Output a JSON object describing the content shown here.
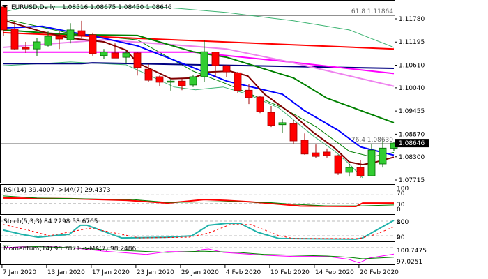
{
  "header": {
    "symbol": "EURUSD,Daily",
    "ohlc": "1.08516 1.08675 1.08450 1.08646"
  },
  "chart_data": {
    "type": "candlestick",
    "title": "EURUSD,Daily",
    "price_axis": {
      "ticks": [
        "1.11780",
        "1.11195",
        "1.10610",
        "1.10040",
        "1.09455",
        "1.08870",
        "1.08300",
        "1.07715"
      ],
      "current": "1.08646",
      "current_value": 1.08646
    },
    "x_labels": [
      {
        "i": -0.1,
        "label": "7 Jan 2020"
      },
      {
        "i": 3.9,
        "label": "13 Jan 2020"
      },
      {
        "i": 7.9,
        "label": "17 Jan 2020"
      },
      {
        "i": 11.9,
        "label": "23 Jan 2020"
      },
      {
        "i": 15.9,
        "label": "29 Jan 2020"
      },
      {
        "i": 19.9,
        "label": "4 Feb 2020"
      },
      {
        "i": 23.9,
        "label": "10 Feb 2020"
      },
      {
        "i": 27.9,
        "label": "14 Feb 2020"
      },
      {
        "i": 31.9,
        "label": "20 Feb 2020"
      }
    ],
    "fib_levels": [
      {
        "label": "61.8 1.11864",
        "value": 1.11864
      },
      {
        "label": "76.4 1.08630",
        "value": 1.0863
      }
    ],
    "candles": [
      [
        1.1208,
        1.1208,
        1.1134,
        1.115
      ],
      [
        1.1152,
        1.1173,
        1.1099,
        1.1102
      ],
      [
        1.1106,
        1.112,
        1.1092,
        1.1102
      ],
      [
        1.1102,
        1.1129,
        1.1083,
        1.112
      ],
      [
        1.1111,
        1.1146,
        1.1108,
        1.1134
      ],
      [
        1.1134,
        1.1146,
        1.1102,
        1.1127
      ],
      [
        1.1125,
        1.1167,
        1.1116,
        1.115
      ],
      [
        1.1148,
        1.1173,
        1.1129,
        1.1136
      ],
      [
        1.1138,
        1.1143,
        1.1085,
        1.109
      ],
      [
        1.1085,
        1.1102,
        1.1076,
        1.1094
      ],
      [
        1.1092,
        1.1116,
        1.1079,
        1.1079
      ],
      [
        1.1081,
        1.1097,
        1.1067,
        1.1092
      ],
      [
        1.1092,
        1.1094,
        1.1035,
        1.1055
      ],
      [
        1.1051,
        1.1064,
        1.1018,
        1.1023
      ],
      [
        1.1032,
        1.1035,
        1.1009,
        1.1018
      ],
      [
        1.1018,
        1.1027,
        1.0997,
        1.1021
      ],
      [
        1.1021,
        1.1028,
        1.0998,
        1.1009
      ],
      [
        1.1011,
        1.1037,
        1.1006,
        1.1032
      ],
      [
        1.1032,
        1.1125,
        1.1018,
        1.1095
      ],
      [
        1.1094,
        1.1094,
        1.1032,
        1.106
      ],
      [
        1.106,
        1.1062,
        1.1032,
        1.1044
      ],
      [
        1.1042,
        1.1044,
        1.0991,
        1.0997
      ],
      [
        1.0998,
        1.1014,
        1.0963,
        1.0979
      ],
      [
        1.0981,
        1.0984,
        1.094,
        1.0944
      ],
      [
        1.0942,
        1.0958,
        1.0905,
        1.0909
      ],
      [
        1.0911,
        1.0925,
        1.0891,
        1.0916
      ],
      [
        1.0914,
        1.0923,
        1.0863,
        1.087
      ],
      [
        1.0872,
        1.0889,
        1.0835,
        1.0837
      ],
      [
        1.084,
        1.0861,
        1.0826,
        1.0831
      ],
      [
        1.0842,
        1.0851,
        1.0828,
        1.0833
      ],
      [
        1.0833,
        1.0835,
        1.0784,
        1.0789
      ],
      [
        1.0791,
        1.0812,
        1.078,
        1.0803
      ],
      [
        1.0803,
        1.0821,
        1.0777,
        1.0782
      ],
      [
        1.0782,
        1.0863,
        1.0782,
        1.0847
      ],
      [
        1.0812,
        1.087,
        1.0803,
        1.0852
      ],
      [
        1.08516,
        1.08675,
        1.0845,
        1.08646
      ]
    ],
    "lines": [
      {
        "name": "upper-band",
        "color": "#3cb371",
        "width": 1,
        "points": [
          [
            0,
            1.1195
          ],
          [
            2,
            1.1208
          ],
          [
            14,
            1.1208
          ],
          [
            20,
            1.1194
          ],
          [
            26,
            1.1173
          ],
          [
            31,
            1.115
          ],
          [
            35,
            1.1106
          ]
        ]
      },
      {
        "name": "lower-band",
        "color": "#3cb371",
        "width": 1,
        "points": [
          [
            0,
            1.106
          ],
          [
            6,
            1.1069
          ],
          [
            11,
            1.1062
          ],
          [
            15.3,
            1.1006
          ],
          [
            17.2,
            1.0999
          ],
          [
            19.7,
            1.1006
          ],
          [
            21.9,
            1.0988
          ],
          [
            24.7,
            1.0953
          ],
          [
            27.8,
            1.0882
          ],
          [
            29.7,
            1.0844
          ],
          [
            31,
            1.0812
          ],
          [
            32.2,
            1.0777
          ]
        ]
      },
      {
        "name": "mid-band",
        "color": "#008000",
        "width": 1,
        "points": [
          [
            0,
            1.1178
          ],
          [
            6,
            1.1141
          ],
          [
            12,
            1.1125
          ],
          [
            17,
            1.1046
          ],
          [
            20,
            1.1014
          ],
          [
            25,
            1.0954
          ],
          [
            28,
            1.0906
          ],
          [
            31,
            1.0844
          ],
          [
            33,
            1.083
          ],
          [
            35,
            1.0841
          ]
        ]
      },
      {
        "name": "ma-red",
        "color": "#ff0000",
        "width": 2,
        "points": [
          [
            0,
            1.1143
          ],
          [
            17,
            1.1123
          ],
          [
            35,
            1.1102
          ]
        ]
      },
      {
        "name": "ma-navy",
        "color": "#000080",
        "width": 2,
        "points": [
          [
            0,
            1.1065
          ],
          [
            7,
            1.1065
          ],
          [
            8,
            1.1067
          ],
          [
            35,
            1.1053
          ]
        ]
      },
      {
        "name": "ma-magenta",
        "color": "#ff00ff",
        "width": 2,
        "points": [
          [
            0,
            1.1094
          ],
          [
            17,
            1.1094
          ],
          [
            25,
            1.1071
          ],
          [
            35,
            1.104
          ]
        ]
      },
      {
        "name": "ma-violet",
        "color": "#ee82ee",
        "width": 2,
        "points": [
          [
            0,
            1.1106
          ],
          [
            9,
            1.1125
          ],
          [
            17,
            1.1109
          ],
          [
            20,
            1.1102
          ],
          [
            26,
            1.1067
          ],
          [
            35,
            1.1008
          ]
        ]
      },
      {
        "name": "ma-green",
        "color": "#008000",
        "width": 2,
        "points": [
          [
            0,
            1.115
          ],
          [
            6,
            1.1138
          ],
          [
            12,
            1.1136
          ],
          [
            17,
            1.1095
          ],
          [
            20,
            1.1081
          ],
          [
            26,
            1.1029
          ],
          [
            29,
            1.0978
          ],
          [
            35,
            1.0916
          ]
        ]
      },
      {
        "name": "ma-blue",
        "color": "#0000ff",
        "width": 2,
        "points": [
          [
            0,
            1.1155
          ],
          [
            3.5,
            1.1159
          ],
          [
            6,
            1.1145
          ],
          [
            9,
            1.1129
          ],
          [
            12,
            1.111
          ],
          [
            17,
            1.1055
          ],
          [
            20,
            1.1021
          ],
          [
            25,
            1.0988
          ],
          [
            27,
            1.0946
          ],
          [
            30,
            1.0897
          ],
          [
            32,
            1.0855
          ],
          [
            35,
            1.0834
          ]
        ]
      },
      {
        "name": "ma-darkred",
        "color": "#800000",
        "width": 2,
        "points": [
          [
            0.2,
            1.1173
          ],
          [
            3.4,
            1.1146
          ],
          [
            6,
            1.1129
          ],
          [
            9,
            1.112
          ],
          [
            11,
            1.1099
          ],
          [
            12,
            1.1067
          ],
          [
            15,
            1.1027
          ],
          [
            17,
            1.1029
          ],
          [
            18.4,
            1.1044
          ],
          [
            20.3,
            1.1046
          ],
          [
            21.9,
            1.1034
          ],
          [
            23.4,
            1.0988
          ],
          [
            26,
            1.0935
          ],
          [
            27.8,
            1.0891
          ],
          [
            29.7,
            1.0852
          ],
          [
            31,
            1.0817
          ],
          [
            32.2,
            1.081
          ],
          [
            33.4,
            1.0817
          ],
          [
            35,
            1.0829
          ]
        ]
      }
    ],
    "indicators": {
      "rsi": {
        "label": "RSI(14) 39.4007  ->MA(7) 29.4373",
        "range": [
          0,
          100
        ],
        "levels": [
          70,
          30
        ],
        "axis": [
          "100",
          "70",
          "30",
          "0"
        ],
        "series": [
          {
            "name": "rsi",
            "color": "#ff0000",
            "width": 2,
            "points": [
              [
                0,
                55
              ],
              [
                6,
                52
              ],
              [
                11,
                45
              ],
              [
                14.7,
                32
              ],
              [
                16,
                38
              ],
              [
                18,
                48
              ],
              [
                20,
                44
              ],
              [
                22,
                38
              ],
              [
                24,
                30
              ],
              [
                26.6,
                18
              ],
              [
                31.6,
                16
              ],
              [
                32.2,
                32
              ],
              [
                35,
                32
              ]
            ]
          },
          {
            "name": "rsi-ma",
            "color": "#008000",
            "width": 1,
            "points": [
              [
                0,
                65
              ],
              [
                3,
                55
              ],
              [
                11.6,
                48
              ],
              [
                14.7,
                35
              ],
              [
                18,
                37
              ],
              [
                20.3,
                39
              ],
              [
                24,
                34
              ],
              [
                26,
                26
              ],
              [
                29,
                19
              ],
              [
                32.2,
                19
              ],
              [
                35,
                23
              ]
            ]
          }
        ]
      },
      "stoch": {
        "label": "Stoch(5,3,3) 84.2298 58.6765",
        "range": [
          0,
          100
        ],
        "levels": [
          80,
          20
        ],
        "axis": [
          "80",
          "100",
          "0",
          "20"
        ],
        "series": [
          {
            "name": "stoch-main",
            "color": "#20b2aa",
            "width": 2,
            "points": [
              [
                0,
                43
              ],
              [
                1.6,
                26
              ],
              [
                3.1,
                14
              ],
              [
                5.9,
                26
              ],
              [
                6.9,
                63
              ],
              [
                7.5,
                63
              ],
              [
                9.7,
                26
              ],
              [
                10.6,
                11
              ],
              [
                14.7,
                14
              ],
              [
                16.9,
                20
              ],
              [
                18.4,
                63
              ],
              [
                20,
                71
              ],
              [
                21.2,
                71
              ],
              [
                22.8,
                34
              ],
              [
                24.7,
                9
              ],
              [
                31.6,
                6
              ],
              [
                32.2,
                11
              ],
              [
                35,
                83
              ]
            ]
          },
          {
            "name": "stoch-signal",
            "color": "#ff0000",
            "width": 1,
            "dash": true,
            "points": [
              [
                0,
                66
              ],
              [
                2.2,
                43
              ],
              [
                4.1,
                20
              ],
              [
                7.8,
                51
              ],
              [
                9.7,
                34
              ],
              [
                12.2,
                11
              ],
              [
                16.6,
                14
              ],
              [
                18.4,
                31
              ],
              [
                20.3,
                66
              ],
              [
                22.2,
                66
              ],
              [
                24.7,
                20
              ],
              [
                26,
                9
              ],
              [
                31.9,
                9
              ],
              [
                33.4,
                26
              ],
              [
                35,
                57
              ]
            ]
          }
        ]
      },
      "momentum": {
        "label": "Momentum(14) 98.7871  ->MA(7) 98.2486",
        "range": [
          95.1,
          101.4
        ],
        "levels": [
          100
        ],
        "axis": [
          "100",
          "100.7475",
          "97.0251"
        ],
        "series": [
          {
            "name": "momentum",
            "color": "#ff00ff",
            "width": 1,
            "points": [
              [
                0,
                100
              ],
              [
                3.4,
                100.35
              ],
              [
                6,
                100
              ],
              [
                9,
                99.1
              ],
              [
                12.8,
                98.3
              ],
              [
                14.7,
                99
              ],
              [
                17.2,
                99
              ],
              [
                17.8,
                99.5
              ],
              [
                18.4,
                99.65
              ],
              [
                19.7,
                98.8
              ],
              [
                23.4,
                98.1
              ],
              [
                25.9,
                97.8
              ],
              [
                29,
                97.8
              ],
              [
                30.9,
                97.1
              ],
              [
                31.9,
                96.2
              ],
              [
                32.8,
                97.4
              ],
              [
                35,
                98.4
              ]
            ]
          },
          {
            "name": "momentum-ma",
            "color": "#008000",
            "width": 1,
            "points": [
              [
                0,
                100.5
              ],
              [
                6,
                100
              ],
              [
                9,
                99.5
              ],
              [
                14.7,
                98.8
              ],
              [
                17.8,
                99.1
              ],
              [
                21,
                98.8
              ],
              [
                23.4,
                98.3
              ],
              [
                29,
                97.9
              ],
              [
                30.9,
                97.6
              ],
              [
                32.2,
                97.2
              ],
              [
                35,
                97.6
              ]
            ]
          }
        ]
      }
    }
  }
}
